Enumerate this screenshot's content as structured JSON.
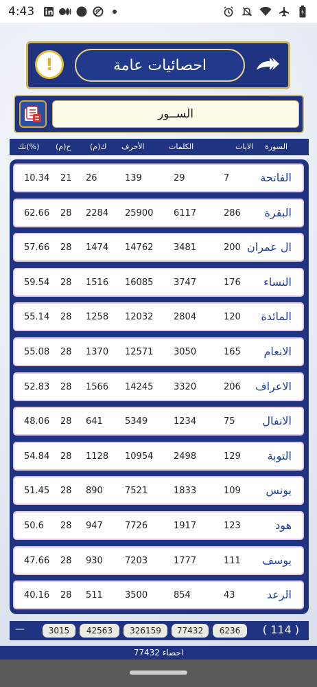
{
  "status": {
    "time": "4:43"
  },
  "header": {
    "title": "احصائيات عامة"
  },
  "search": {
    "value": "الســور"
  },
  "columns": [
    "السورة",
    "الايات",
    "الكلمات",
    "الأحرف",
    "ك(م)",
    "ح(م)",
    "تك(%)"
  ],
  "rows": [
    {
      "name": "الفاتحة",
      "ayat": "7",
      "words": "29",
      "letters": "139",
      "km": "26",
      "hm": "21",
      "tk": "10.34"
    },
    {
      "name": "البقرة",
      "ayat": "286",
      "words": "6117",
      "letters": "25900",
      "km": "2284",
      "hm": "28",
      "tk": "62.66"
    },
    {
      "name": "ال عمران",
      "ayat": "200",
      "words": "3481",
      "letters": "14762",
      "km": "1474",
      "hm": "28",
      "tk": "57.66"
    },
    {
      "name": "النساء",
      "ayat": "176",
      "words": "3747",
      "letters": "16085",
      "km": "1516",
      "hm": "28",
      "tk": "59.54"
    },
    {
      "name": "المائدة",
      "ayat": "120",
      "words": "2804",
      "letters": "12032",
      "km": "1258",
      "hm": "28",
      "tk": "55.14"
    },
    {
      "name": "الانعام",
      "ayat": "165",
      "words": "3050",
      "letters": "12571",
      "km": "1370",
      "hm": "28",
      "tk": "55.08"
    },
    {
      "name": "الاعراف",
      "ayat": "206",
      "words": "3320",
      "letters": "14245",
      "km": "1566",
      "hm": "28",
      "tk": "52.83"
    },
    {
      "name": "الانفال",
      "ayat": "75",
      "words": "1234",
      "letters": "5349",
      "km": "641",
      "hm": "28",
      "tk": "48.06"
    },
    {
      "name": "التوبة",
      "ayat": "129",
      "words": "2498",
      "letters": "10954",
      "km": "1128",
      "hm": "28",
      "tk": "54.84"
    },
    {
      "name": "يونس",
      "ayat": "109",
      "words": "1833",
      "letters": "7521",
      "km": "890",
      "hm": "28",
      "tk": "51.45"
    },
    {
      "name": "هود",
      "ayat": "123",
      "words": "1917",
      "letters": "7726",
      "km": "947",
      "hm": "28",
      "tk": "50.6"
    },
    {
      "name": "يوسف",
      "ayat": "111",
      "words": "1777",
      "letters": "7203",
      "km": "930",
      "hm": "28",
      "tk": "47.66"
    },
    {
      "name": "الرعد",
      "ayat": "43",
      "words": "854",
      "letters": "3500",
      "km": "511",
      "hm": "28",
      "tk": "40.16"
    }
  ],
  "totals": {
    "dash": "—",
    "values": [
      "3015",
      "42563",
      "326159",
      "77432",
      "6236"
    ],
    "count": "( 114 )"
  },
  "footer": {
    "stat": "احصاء 77432"
  },
  "icons": {
    "alert": "exclamation-circle-icon",
    "forward": "double-chevron-forward-icon",
    "list": "list-book-icon"
  },
  "colors": {
    "primary": "#1f3380",
    "gold": "#c8b46a",
    "surah_name": "#1f3e9c"
  }
}
